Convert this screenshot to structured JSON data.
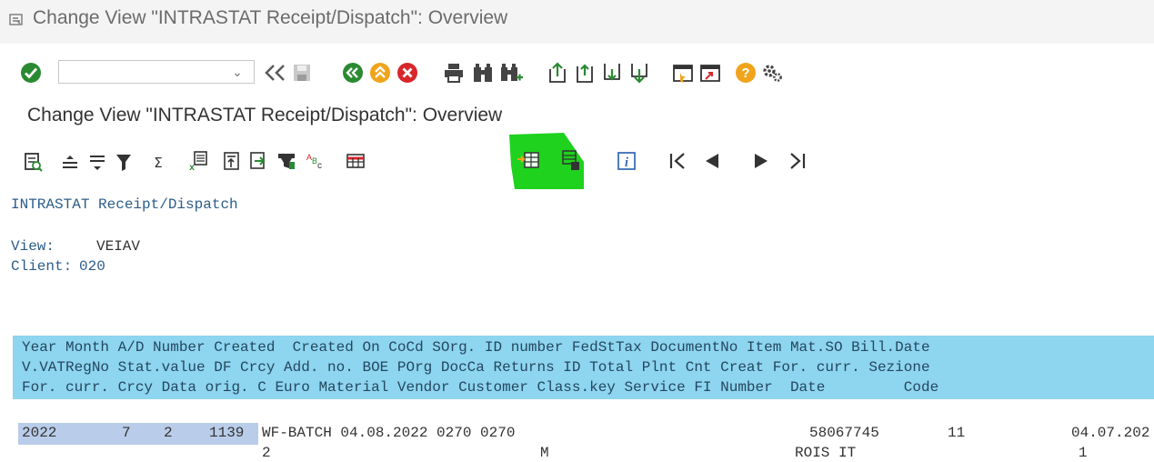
{
  "window": {
    "title": "Change View \"INTRASTAT Receipt/Dispatch\": Overview"
  },
  "toolbar": {
    "command_field_value": "",
    "icons": [
      "enter-icon",
      "back-icon",
      "save-icon",
      "back-green-icon",
      "exit-icon",
      "cancel-icon",
      "print-icon",
      "find-icon",
      "find-next-icon",
      "first-page-icon",
      "previous-page-icon",
      "next-page-icon",
      "last-page-icon",
      "create-session-icon",
      "shortcut-icon",
      "help-icon",
      "settings-icon"
    ]
  },
  "app": {
    "title": "Change View \"INTRASTAT Receipt/Dispatch\": Overview"
  },
  "app_toolbar": {
    "icons": [
      "details-icon",
      "sort-ascending-icon",
      "sort-descending-icon",
      "filter-icon",
      "sum-icon",
      "export-icon",
      "print-preview-icon",
      "send-icon",
      "layout-icon",
      "abc-icon",
      "table-view-icon",
      "insert-row-icon",
      "copy-row-icon",
      "info-icon",
      "first-icon",
      "previous-icon",
      "next-icon",
      "last-icon"
    ]
  },
  "content": {
    "heading": "INTRASTAT Receipt/Dispatch",
    "view_label": "View:",
    "view_value": "VEIAV",
    "client_label": "Client:",
    "client_value": "020",
    "header_lines": [
      "Year Month A/D Number Created  Created On CoCd SOrg. ID number FedStTax DocumentNo Item Mat.SO Bill.Date",
      "V.VATRegNo Stat.value DF Crcy Add. no. BOE POrg DocCa Returns ID Total Plnt Cnt Creat For. curr. Sezione",
      "For. curr. Crcy Data orig. C Euro Material Vendor Customer Class.key Service FI Number  Date         Code"
    ],
    "row": {
      "year": "2022",
      "month": "7",
      "ad": "2",
      "number": "1139",
      "line1_rest": "WF-BATCH 04.08.2022 0270 0270",
      "document_no": "58067745",
      "item": "11",
      "bill_date": "04.07.202",
      "line2_a": "2",
      "line2_b": "M",
      "line2_c": "ROIS IT",
      "line2_d": "1"
    }
  },
  "highlight": {
    "color": "#1ed21e"
  }
}
